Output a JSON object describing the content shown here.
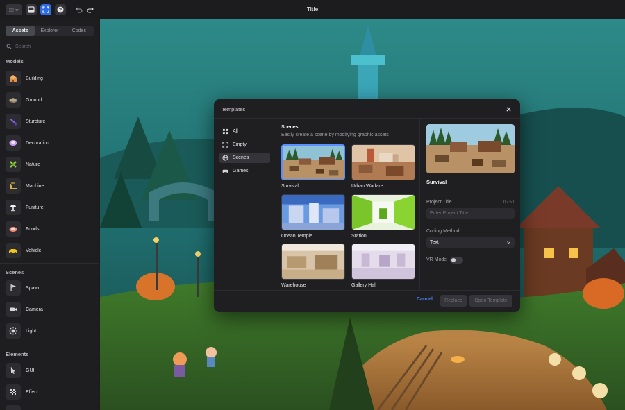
{
  "app": {
    "title": "Title"
  },
  "toolbar": {
    "menu_icon": "menu-icon",
    "layout_icon": "layout-icon",
    "fullscreen_icon": "fullscreen-icon",
    "help_icon": "help-icon",
    "undo_icon": "undo-icon",
    "redo_icon": "redo-icon",
    "accent": "#2f6be8"
  },
  "sidebar": {
    "tabs": [
      {
        "label": "Assets",
        "active": true
      },
      {
        "label": "Explorer",
        "active": false
      },
      {
        "label": "Codes",
        "active": false
      }
    ],
    "search": {
      "placeholder": "Search",
      "value": ""
    },
    "sections": [
      {
        "title": "Models",
        "items": [
          {
            "label": "Building",
            "icon": "building-icon"
          },
          {
            "label": "Ground",
            "icon": "ground-icon"
          },
          {
            "label": "Sturcture",
            "icon": "structure-icon"
          },
          {
            "label": "Decoration",
            "icon": "decoration-icon"
          },
          {
            "label": "Nature",
            "icon": "nature-icon"
          },
          {
            "label": "Machine",
            "icon": "machine-icon"
          },
          {
            "label": "Funiture",
            "icon": "furniture-icon"
          },
          {
            "label": "Foods",
            "icon": "foods-icon"
          },
          {
            "label": "Vehicle",
            "icon": "vehicle-icon"
          }
        ]
      },
      {
        "title": "Scenes",
        "items": [
          {
            "label": "Spawn",
            "icon": "flag-icon"
          },
          {
            "label": "Camera",
            "icon": "camera-icon"
          },
          {
            "label": "Light",
            "icon": "sun-icon"
          }
        ]
      },
      {
        "title": "Elements",
        "items": [
          {
            "label": "GUI",
            "icon": "cursor-icon"
          },
          {
            "label": "Effect",
            "icon": "sparkle-icon"
          }
        ]
      }
    ]
  },
  "modal": {
    "title": "Templates",
    "close_icon": "close-icon",
    "categories": [
      {
        "label": "All",
        "icon": "grid-icon",
        "active": false
      },
      {
        "label": "Empty",
        "icon": "frame-icon",
        "active": false
      },
      {
        "label": "Scenes",
        "icon": "globe-icon",
        "active": true
      },
      {
        "label": "Games",
        "icon": "gamepad-icon",
        "active": false
      }
    ],
    "section_title": "Scenes",
    "section_subtitle": "Easily create a scene by modifying graphic assets",
    "templates": [
      {
        "label": "Survival",
        "selected": true
      },
      {
        "label": "Urban Warfare",
        "selected": false
      },
      {
        "label": "Ocean Temple",
        "selected": false
      },
      {
        "label": "Station",
        "selected": false
      },
      {
        "label": "Warehouse",
        "selected": false
      },
      {
        "label": "Gallery Hall",
        "selected": false
      }
    ],
    "preview": {
      "name": "Survival",
      "project_title_label": "Project Title",
      "project_title_count": "0 / 50",
      "project_title_placeholder": "Enter Project Title",
      "project_title_value": "",
      "coding_method_label": "Coding Method",
      "coding_method_value": "Text",
      "vr_mode_label": "VR Mode",
      "vr_mode_on": false
    },
    "footer": {
      "cancel_label": "Cancel",
      "replace_label": "Replace",
      "open_label": "Open Template"
    }
  }
}
